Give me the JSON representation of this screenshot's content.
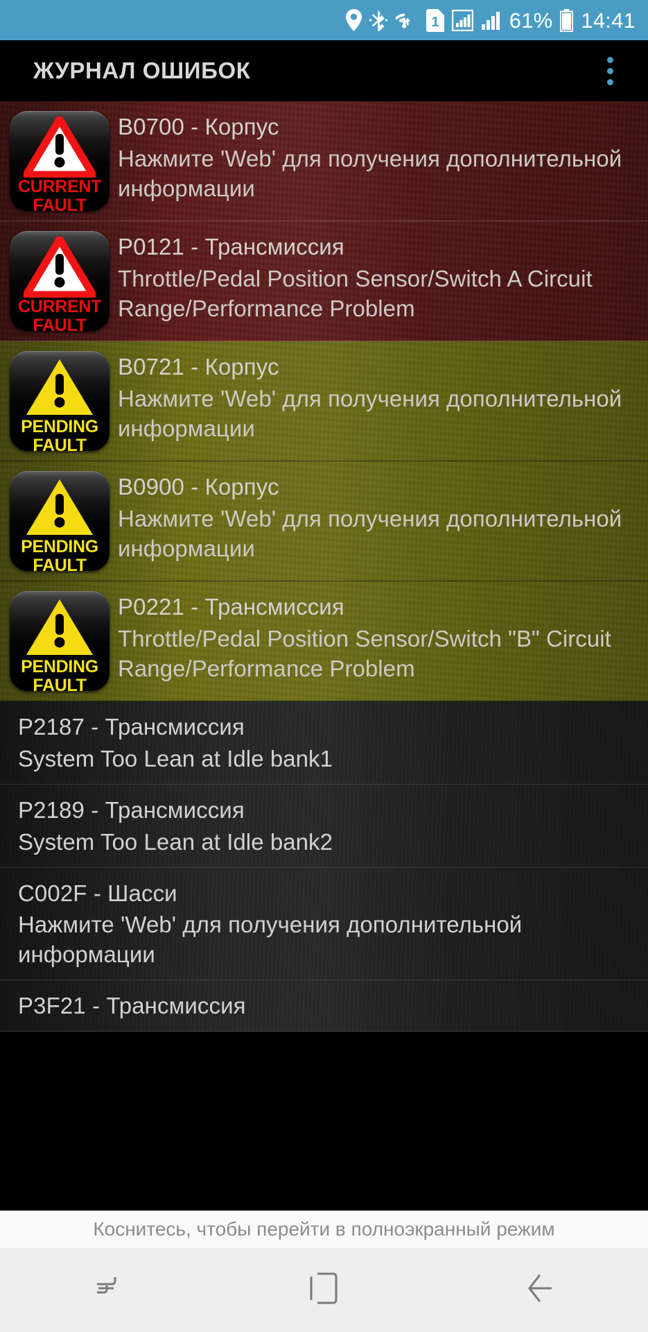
{
  "status_bar": {
    "background": "#4a9cc4",
    "battery_percent": "61%",
    "time": "14:41",
    "icons": [
      "location-pin-icon",
      "bluetooth-icon",
      "wifi-icon",
      "sim1-icon",
      "signal-bars-1-icon",
      "signal-bars-2-icon",
      "battery-icon"
    ]
  },
  "app_bar": {
    "title": "ЖУРНАЛ ОШИБОК",
    "overflow_label": "overflow-menu"
  },
  "colors": {
    "accent": "#4a9cc4",
    "current_fault_bg": "#5c1a1a",
    "pending_fault_bg": "#6d6d16",
    "history_bg": "#252525",
    "current_fault_text": "#e80d0d",
    "pending_fault_text": "#f2e41e"
  },
  "faults": [
    {
      "severity": "current",
      "badge_line1": "CURRENT",
      "badge_line2": "FAULT",
      "badge_icon": "warning-triangle-red-icon",
      "code": "B0700 - Корпус",
      "description": "Нажмите 'Web' для получения дополнительной информации"
    },
    {
      "severity": "current",
      "badge_line1": "CURRENT",
      "badge_line2": "FAULT",
      "badge_icon": "warning-triangle-red-icon",
      "code": "P0121 - Трансмиссия",
      "description": "Throttle/Pedal Position Sensor/Switch A Circuit Range/Performance Problem"
    },
    {
      "severity": "pending",
      "badge_line1": "PENDING",
      "badge_line2": "FAULT",
      "badge_icon": "warning-triangle-yellow-icon",
      "code": "B0721 - Корпус",
      "description": "Нажмите 'Web' для получения дополнительной информации"
    },
    {
      "severity": "pending",
      "badge_line1": "PENDING",
      "badge_line2": "FAULT",
      "badge_icon": "warning-triangle-yellow-icon",
      "code": "B0900 - Корпус",
      "description": "Нажмите 'Web' для получения дополнительной информации"
    },
    {
      "severity": "pending",
      "badge_line1": "PENDING",
      "badge_line2": "FAULT",
      "badge_icon": "warning-triangle-yellow-icon",
      "code": "P0221 - Трансмиссия",
      "description": "Throttle/Pedal Position Sensor/Switch \"B\" Circuit Range/Performance Problem"
    },
    {
      "severity": "history",
      "code": "P2187 - Трансмиссия",
      "description": "System Too Lean at Idle bank1"
    },
    {
      "severity": "history",
      "code": "P2189 - Трансмиссия",
      "description": "System Too Lean at Idle bank2"
    },
    {
      "severity": "history",
      "code": "C002F - Шасси",
      "description": "Нажмите 'Web' для получения дополнительной информации"
    },
    {
      "severity": "history",
      "code": "P3F21 - Трансмиссия",
      "description": ""
    }
  ],
  "hint_bar": {
    "text": "Коснитесь, чтобы перейти в полноэкранный режим"
  },
  "nav_bar": {
    "recents_label": "recents-button",
    "home_label": "home-button",
    "back_label": "back-button"
  }
}
